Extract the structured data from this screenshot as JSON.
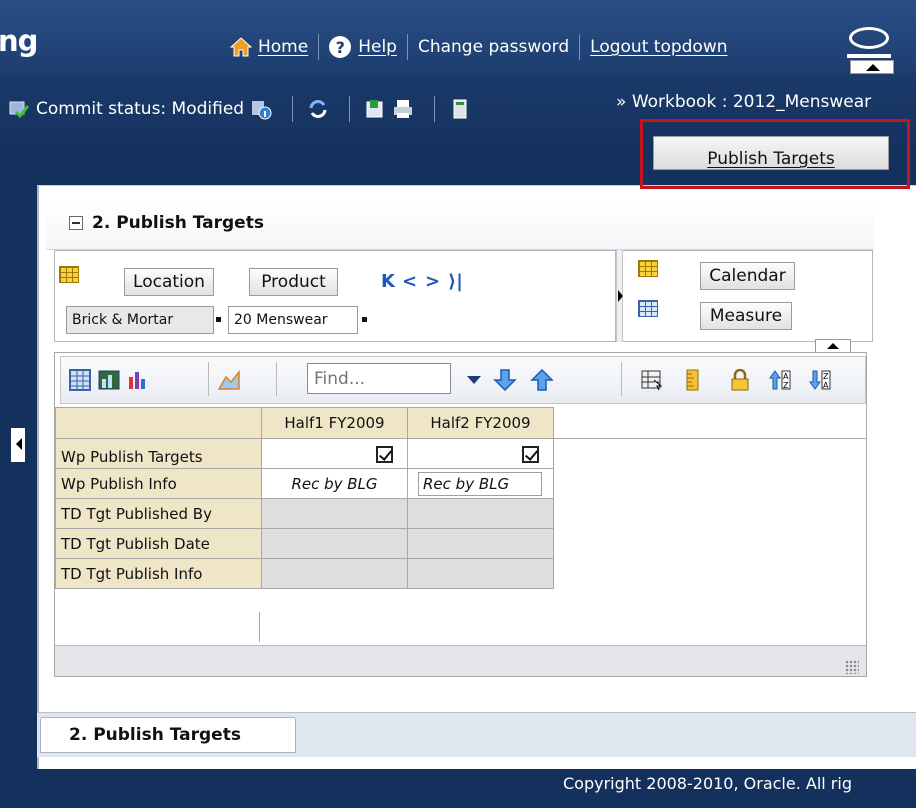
{
  "header": {
    "app_title_fragment": "ng",
    "nav": {
      "home": "Home",
      "help": "Help",
      "change_password": "Change password",
      "logout": "Logout topdown"
    },
    "icons": [
      "home-icon",
      "help-icon",
      "oracle-logo-icon"
    ]
  },
  "toolbar": {
    "commit_status": "Commit status: Modified",
    "workbook": "Workbook : 2012_Menswear",
    "chevron": "»",
    "publish_targets_button": "Publish Targets",
    "icons": [
      "commit-icon",
      "commit-info-icon",
      "refresh-icon",
      "export-excel-icon",
      "print-icon",
      "calculator-icon"
    ]
  },
  "section": {
    "title": "2. Publish Targets"
  },
  "dimensions": {
    "location": "Location",
    "product": "Product",
    "calendar": "Calendar",
    "measure": "Measure",
    "location_member": "Brick & Mortar",
    "product_member": "20 Menswear",
    "page_nav": {
      "first": "K",
      "prev": "<",
      "next": ">",
      "last": "K"
    }
  },
  "grid_toolbar": {
    "find_placeholder": "Find..."
  },
  "grid": {
    "columns": [
      "Half1 FY2009",
      "Half2 FY2009"
    ],
    "rows": [
      {
        "label": "Wp Publish Targets",
        "values": [
          "checked",
          "checked"
        ]
      },
      {
        "label": "Wp Publish Info",
        "values": [
          "Rec by BLG",
          "Rec by BLG"
        ]
      },
      {
        "label": "TD Tgt Published By",
        "values": [
          "",
          ""
        ]
      },
      {
        "label": "TD Tgt Publish Date",
        "values": [
          "",
          ""
        ]
      },
      {
        "label": "TD Tgt Publish Info",
        "values": [
          "",
          ""
        ]
      }
    ]
  },
  "tabs": {
    "active": "2. Publish Targets"
  },
  "footer": {
    "copyright": "Copyright 2008-2010, Oracle. All rig"
  },
  "colors": {
    "header_bg": "#1d3d6f",
    "highlight": "#c4151c",
    "grid_header": "#efe6c8",
    "readonly_cell": "#dedede"
  }
}
